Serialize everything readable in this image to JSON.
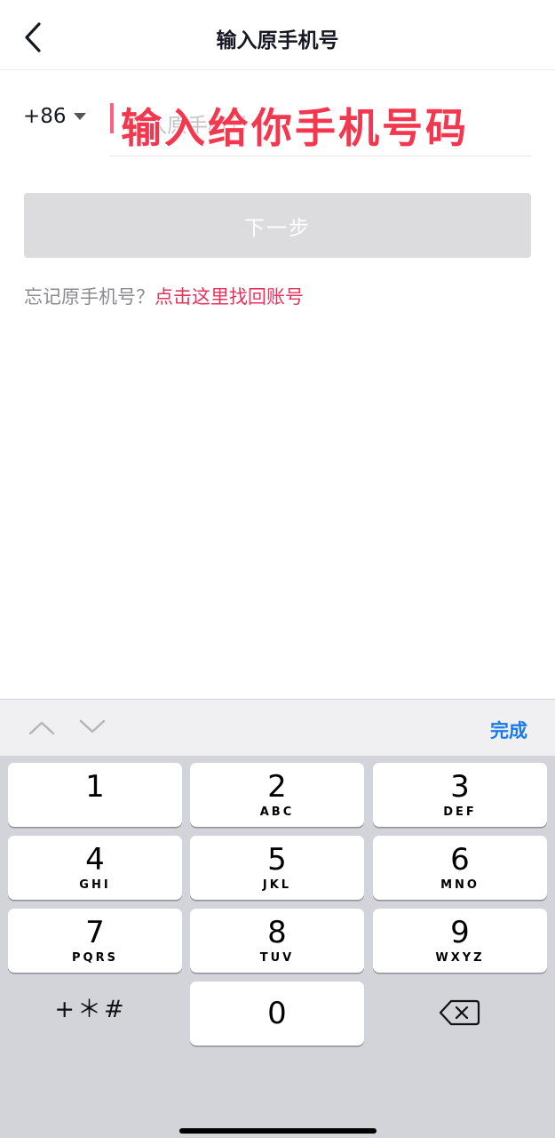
{
  "nav": {
    "title": "输入原手机号"
  },
  "form": {
    "country_code": "+86",
    "phone_placeholder": "输入原手机号",
    "overlay_text": "输入给你手机号码",
    "next_label": "下一步",
    "forgot_text": "忘记原手机号？",
    "forgot_link": "点击这里找回账号"
  },
  "toolbar": {
    "done_label": "完成"
  },
  "keypad": {
    "keys": [
      {
        "num": "1",
        "letters": ""
      },
      {
        "num": "2",
        "letters": "ABC"
      },
      {
        "num": "3",
        "letters": "DEF"
      },
      {
        "num": "4",
        "letters": "GHI"
      },
      {
        "num": "5",
        "letters": "JKL"
      },
      {
        "num": "6",
        "letters": "MNO"
      },
      {
        "num": "7",
        "letters": "PQRS"
      },
      {
        "num": "8",
        "letters": "TUV"
      },
      {
        "num": "9",
        "letters": "WXYZ"
      }
    ],
    "symbols_label": "+＊#",
    "zero": "0"
  },
  "colors": {
    "accent": "#fe2c55",
    "link": "#e5335c",
    "done": "#1a7ae6",
    "button_disabled": "#dcdcdf"
  },
  "icons": {
    "back": "chevron-left-icon",
    "up": "chevron-up-icon",
    "down": "chevron-down-icon",
    "delete": "backspace-icon",
    "dropdown": "triangle-down-icon"
  }
}
